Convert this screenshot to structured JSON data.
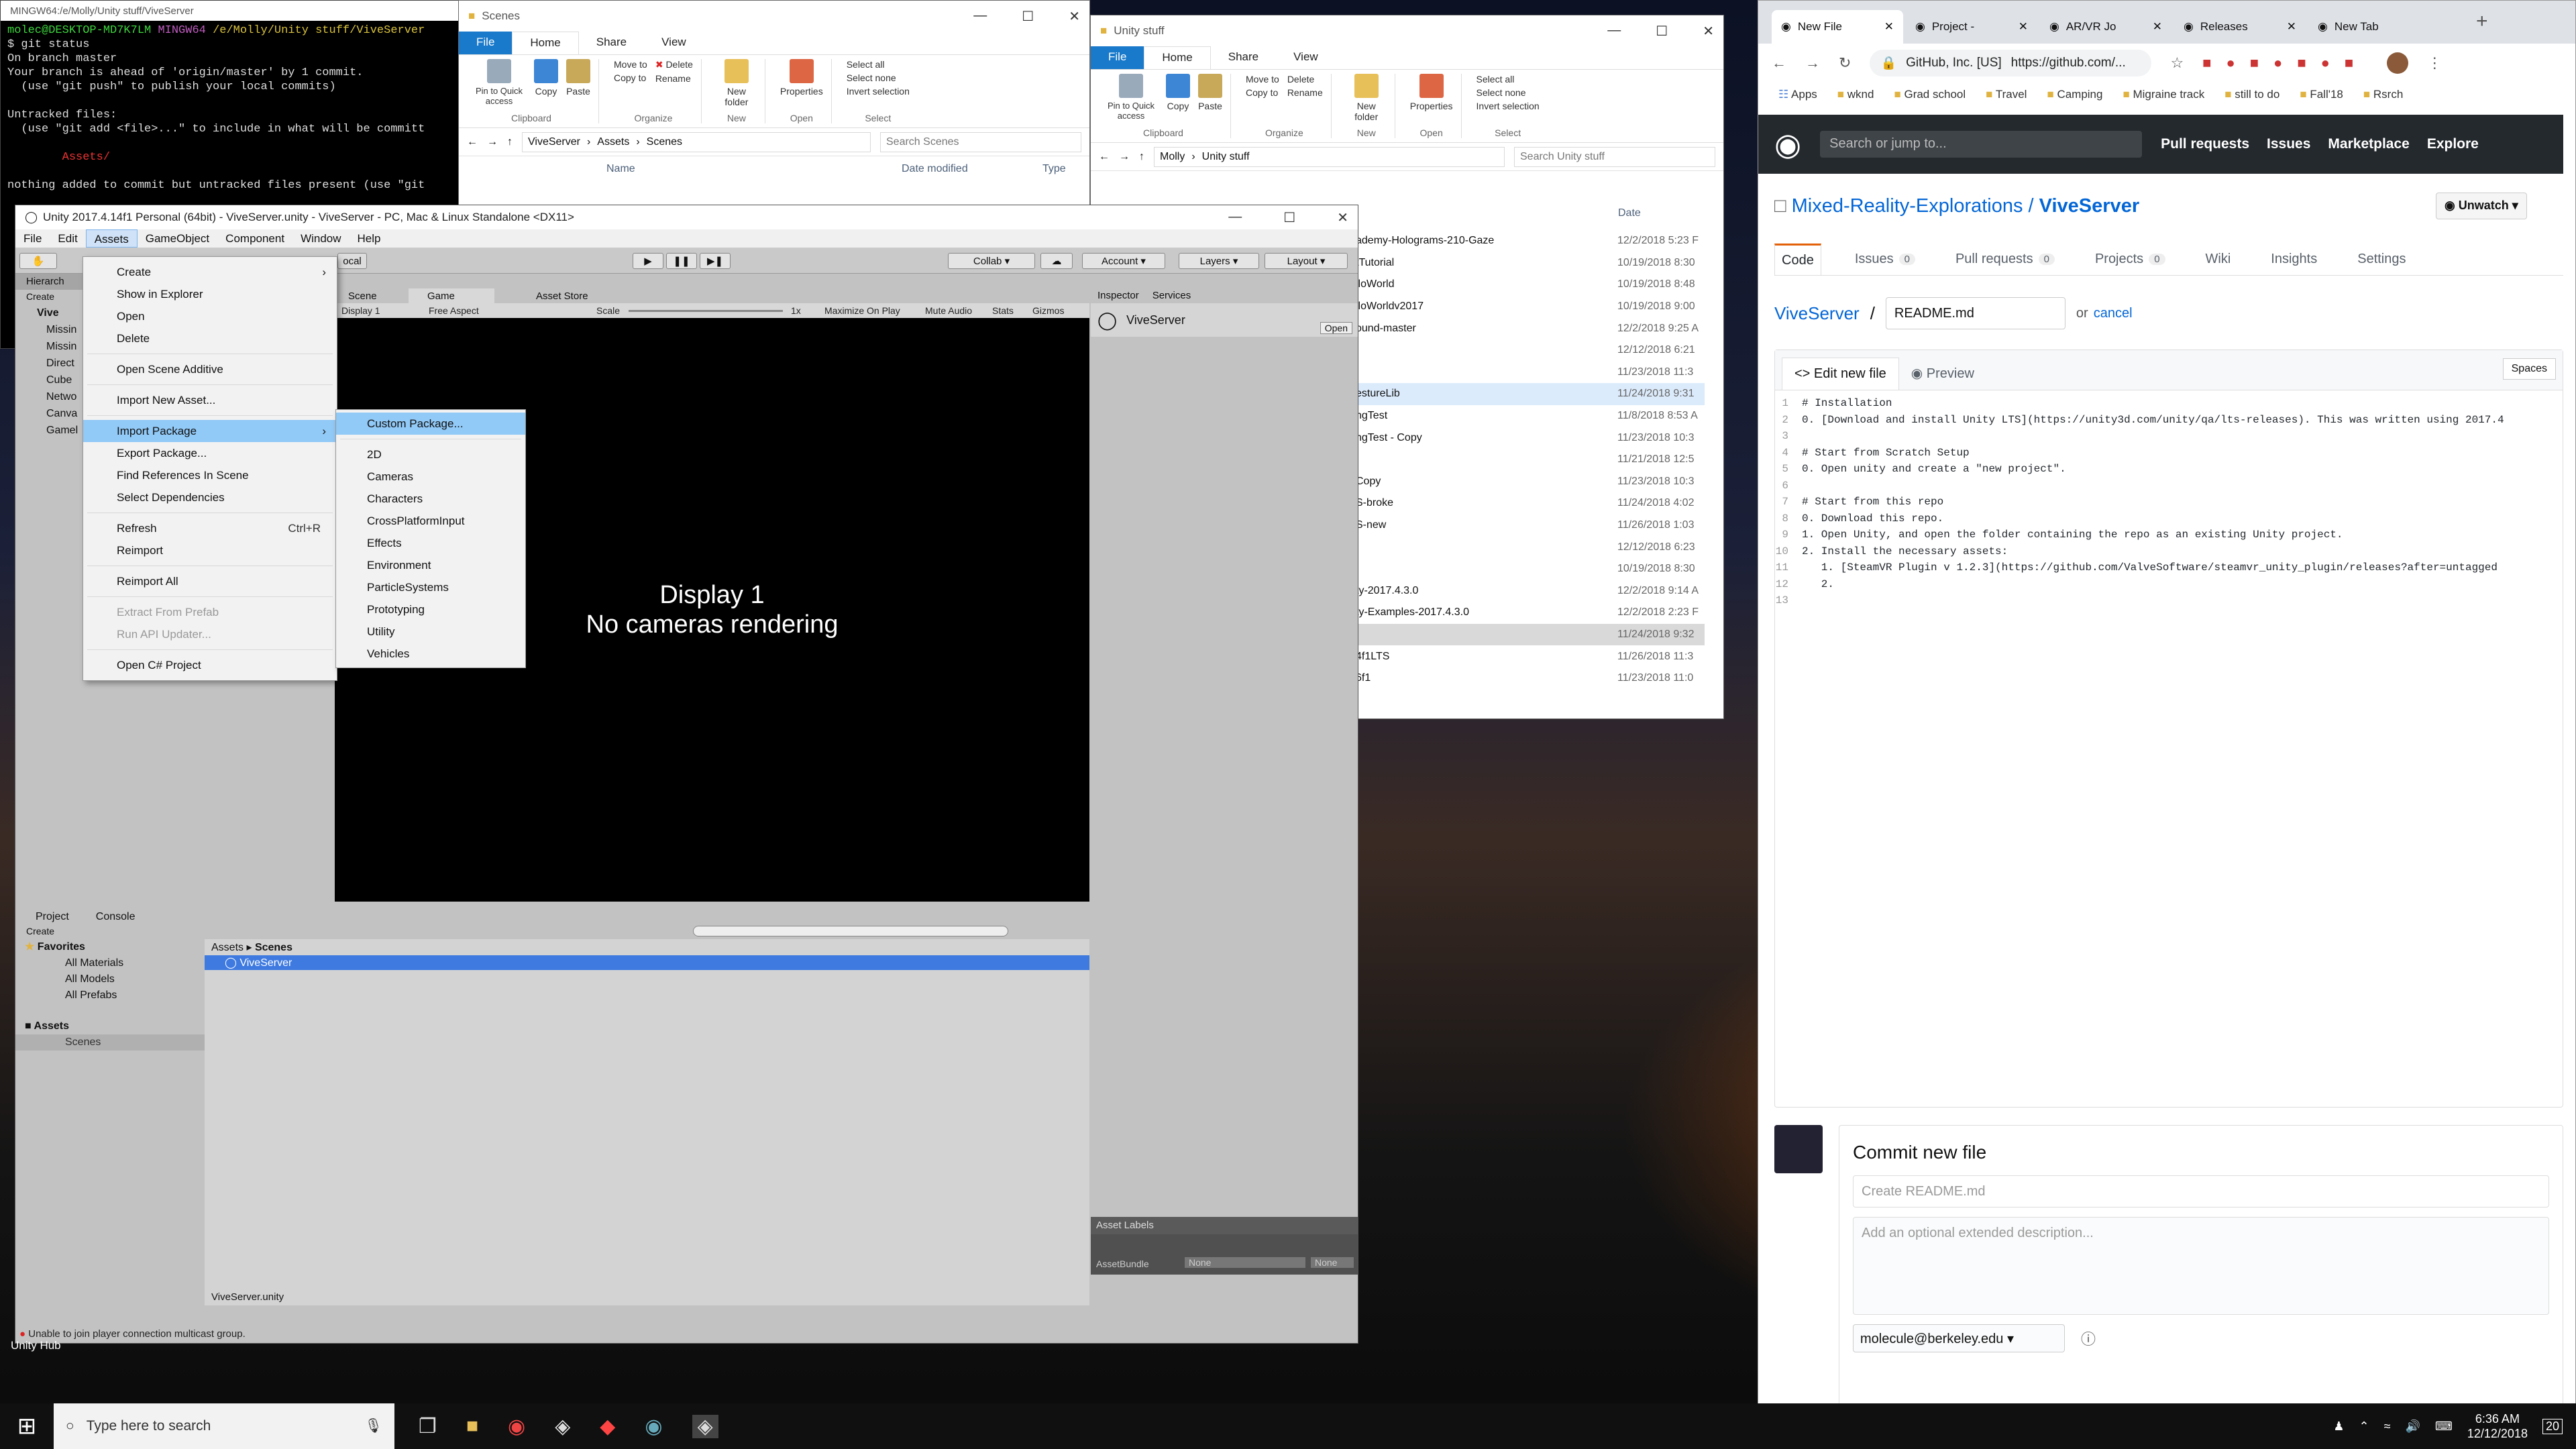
{
  "terminal": {
    "title": "MINGW64:/e/Molly/Unity stuff/ViveServer",
    "prompt_user": "molec@DESKTOP-MD7K7LM",
    "prompt_env": "MINGW64",
    "prompt_path": "/e/Molly/Unity stuff/ViveServer",
    "lines": [
      "$ git status",
      "On branch master",
      "Your branch is ahead of 'origin/master' by 1 commit.",
      "  (use \"git push\" to publish your local commits)",
      "",
      "Untracked files:",
      "  (use \"git add <file>...\" to include in what will be committ",
      "",
      "        Assets/",
      "",
      "nothing added to commit but untracked files present (use \"git"
    ]
  },
  "explorer1": {
    "title": "Scenes",
    "tabs": [
      "File",
      "Home",
      "Share",
      "View"
    ],
    "path": [
      "ViveServer",
      "Assets",
      "Scenes"
    ],
    "search": "Search Scenes",
    "cols": [
      "Name",
      "Date modified",
      "Type"
    ],
    "groups": {
      "clipboard": "Clipboard",
      "organize": "Organize",
      "new": "New",
      "open": "Open",
      "select": "Select"
    },
    "buttons": {
      "pin": "Pin to Quick access",
      "copy": "Copy",
      "paste": "Paste",
      "move": "Move to",
      "copyto": "Copy to",
      "delete": "Delete",
      "rename": "Rename",
      "newfolder": "New folder",
      "properties": "Properties",
      "selectall": "Select all",
      "selectnone": "Select none",
      "invert": "Invert selection"
    }
  },
  "explorer2": {
    "title": "Unity stuff",
    "path": [
      "Molly",
      "Unity stuff"
    ],
    "search": "Search Unity stuff",
    "col_date": "Date",
    "rows": [
      {
        "name": "ademy-Holograms-210-Gaze",
        "date": "12/2/2018 5:23 F"
      },
      {
        "name": "tTutorial",
        "date": "10/19/2018 8:30"
      },
      {
        "name": "lloWorld",
        "date": "10/19/2018 8:48"
      },
      {
        "name": "lloWorldv2017",
        "date": "10/19/2018 9:00"
      },
      {
        "name": "ound-master",
        "date": "12/2/2018 9:25 A"
      },
      {
        "name": "",
        "date": "12/12/2018 6:21"
      },
      {
        "name": "",
        "date": "11/23/2018 11:3"
      },
      {
        "name": "estureLib",
        "date": "11/24/2018 9:31"
      },
      {
        "name": "ngTest",
        "date": "11/8/2018 8:53 A"
      },
      {
        "name": "ngTest - Copy",
        "date": "11/23/2018 10:3"
      },
      {
        "name": "",
        "date": "11/21/2018 12:5"
      },
      {
        "name": "Copy",
        "date": "11/23/2018 10:3"
      },
      {
        "name": "S-broke",
        "date": "11/24/2018 4:02"
      },
      {
        "name": "S-new",
        "date": "11/26/2018 1:03"
      },
      {
        "name": "",
        "date": "12/12/2018 6:23"
      },
      {
        "name": "",
        "date": "10/19/2018 8:30"
      },
      {
        "name": "ty-2017.4.3.0",
        "date": "12/2/2018 9:14 A"
      },
      {
        "name": "ty-Examples-2017.4.3.0",
        "date": "12/2/2018 2:23 F"
      },
      {
        "name": "",
        "date": "11/24/2018 9:32"
      },
      {
        "name": "4f1LTS",
        "date": "11/26/2018 11:3"
      },
      {
        "name": "6f1",
        "date": "11/23/2018 11:0"
      }
    ]
  },
  "unity": {
    "title": "Unity 2017.4.14f1 Personal (64bit) - ViveServer.unity - ViveServer - PC, Mac & Linux Standalone <DX11>",
    "menu": [
      "File",
      "Edit",
      "Assets",
      "GameObject",
      "Component",
      "Window",
      "Help"
    ],
    "toolbar": {
      "collab": "Collab",
      "account": "Account",
      "layers": "Layers",
      "layout": "Layout",
      "local": "ocal"
    },
    "tabs": {
      "hierarchy": "Hierarch",
      "scene": "Scene",
      "game": "Game",
      "store": "Asset Store",
      "inspector": "Inspector",
      "services": "Services",
      "project": "Project",
      "console": "Console"
    },
    "game_bar": {
      "display": "Display 1",
      "aspect": "Free Aspect",
      "scale": "Scale",
      "scale_val": "1x",
      "max": "Maximize On Play",
      "mute": "Mute Audio",
      "stats": "Stats",
      "gizmos": "Gizmos"
    },
    "game_msg": [
      "Display 1",
      "No cameras rendering"
    ],
    "hierarchy": {
      "create": "Create",
      "items": [
        "Vive",
        "Missin",
        "Missin",
        "Direct",
        "Cube",
        "Netwo",
        "Canva",
        "Gamel"
      ]
    },
    "inspector": {
      "name": "ViveServer",
      "open": "Open",
      "asset_labels": "Asset Labels",
      "asset_bundle": "AssetBundle",
      "none1": "None",
      "none2": "None"
    },
    "project": {
      "create": "Create",
      "favorites": "Favorites",
      "fav_items": [
        "All Materials",
        "All Models",
        "All Prefabs"
      ],
      "assets": "Assets",
      "scenes": "Scenes",
      "crumb": [
        "Assets",
        "Scenes"
      ],
      "file": "ViveServer",
      "footer": "ViveServer.unity"
    },
    "status": "Unable to join player connection multicast group.",
    "assets_menu": [
      "Create",
      "Show in Explorer",
      "Open",
      "Delete",
      "Open Scene Additive",
      "Import New Asset...",
      "Import Package",
      "Export Package...",
      "Find References In Scene",
      "Select Dependencies",
      "Refresh",
      "Reimport",
      "Reimport All",
      "Extract From Prefab",
      "Run API Updater...",
      "Open C# Project"
    ],
    "refresh_shortcut": "Ctrl+R",
    "import_menu": [
      "Custom Package...",
      "2D",
      "Cameras",
      "Characters",
      "CrossPlatformInput",
      "Effects",
      "Environment",
      "ParticleSystems",
      "Prototyping",
      "Utility",
      "Vehicles"
    ]
  },
  "desktop": {
    "unity_hub": "Unity Hub"
  },
  "chrome": {
    "tabs": [
      "New File",
      "Project -",
      "AR/VR Jo",
      "Releases",
      "New Tab"
    ],
    "site": "GitHub, Inc. [US]",
    "url": "https://github.com/...",
    "bookmarks": [
      "Apps",
      "wknd",
      "Grad school",
      "Travel",
      "Camping",
      "Migraine track",
      "still to do",
      "Fall'18",
      "Rsrch"
    ]
  },
  "github": {
    "search": "Search or jump to...",
    "nav": [
      "Pull requests",
      "Issues",
      "Marketplace",
      "Explore"
    ],
    "owner": "Mixed-Reality-Explorations",
    "repo": "ViveServer",
    "unwatch": "Unwatch",
    "repo_tabs": [
      {
        "label": "Code",
        "count": ""
      },
      {
        "label": "Issues",
        "count": "0"
      },
      {
        "label": "Pull requests",
        "count": "0"
      },
      {
        "label": "Projects",
        "count": "0"
      },
      {
        "label": "Wiki",
        "count": ""
      },
      {
        "label": "Insights",
        "count": ""
      },
      {
        "label": "Settings",
        "count": ""
      }
    ],
    "filename": "README.md",
    "or": "or",
    "cancel": "cancel",
    "edit_tab": "Edit new file",
    "preview_tab": "Preview",
    "spaces": "Spaces",
    "code": [
      "# Installation",
      "0. [Download and install Unity LTS](https://unity3d.com/unity/qa/lts-releases). This was written using 2017.4",
      "",
      "# Start from Scratch Setup",
      "0. Open unity and create a \"new project\".",
      "",
      "# Start from this repo",
      "0. Download this repo.",
      "1. Open Unity, and open the folder containing the repo as an existing Unity project.",
      "2. Install the necessary assets:",
      "   1. [SteamVR Plugin v 1.2.3](https://github.com/ValveSoftware/steamvr_unity_plugin/releases?after=untagged",
      "   2.",
      ""
    ],
    "commit_title": "Commit new file",
    "commit_placeholder": "Create README.md",
    "desc_placeholder": "Add an optional extended description...",
    "email": "molecule@berkeley.edu"
  },
  "taskbar": {
    "search": "Type here to search",
    "time": "6:36 AM",
    "date": "12/12/2018",
    "notif": "20"
  }
}
